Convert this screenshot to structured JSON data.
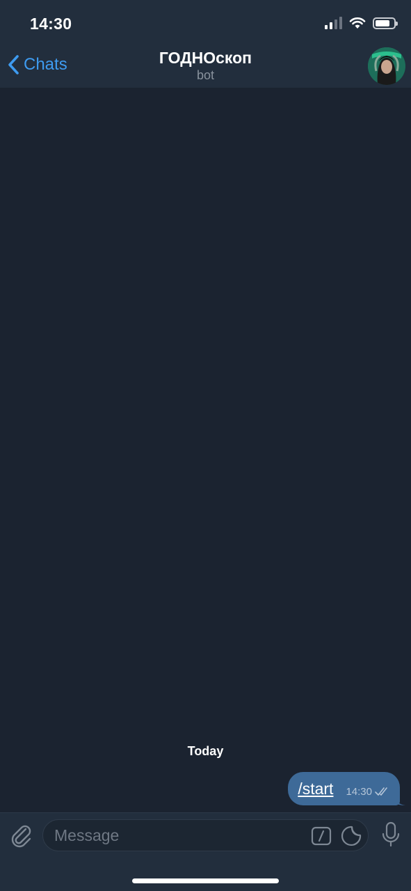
{
  "status_bar": {
    "time": "14:30",
    "battery_level": 0.8,
    "signal_bars": 2
  },
  "header": {
    "back_label": "Chats",
    "title": "ГОДНОскоп",
    "subtitle": "bot"
  },
  "chat": {
    "date_separator": "Today",
    "messages": [
      {
        "text": "/start",
        "time": "14:30",
        "outgoing": true,
        "status": "read"
      }
    ]
  },
  "input": {
    "placeholder": "Message"
  },
  "colors": {
    "accent": "#3e9bf0",
    "outgoing_bubble": "#3e6a98",
    "background": "#1b2330",
    "bar": "#222e3d"
  },
  "icons": [
    "back-chevron-icon",
    "attach-icon",
    "bot-command-icon",
    "sticker-icon",
    "microphone-icon",
    "double-check-icon",
    "wifi-icon",
    "battery-icon",
    "signal-icon"
  ]
}
